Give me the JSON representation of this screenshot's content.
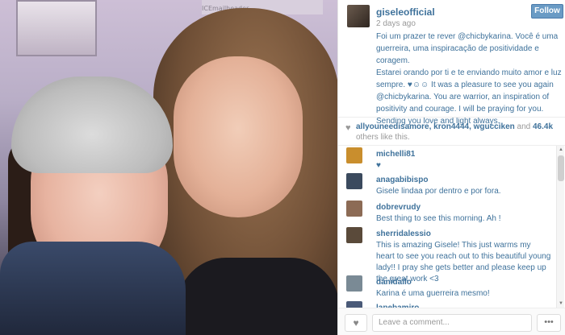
{
  "photo": {
    "watermark": "ICEmailheader"
  },
  "post": {
    "username": "giseleofficial",
    "follow_label": "Follow",
    "time_ago": "2 days ago",
    "caption_lines": [
      "Foi um prazer te rever @chicbykarina. Você é uma",
      "guerreira, uma inspiracação de positividade e coragem.",
      "Estarei orando por ti e te enviando muito amor e luz",
      "sempre. ♥☺☺ It was a pleasure to see you again",
      "@chicbykarina. You are warrior, an inspiration of",
      "positivity and courage. I will be praying for you.",
      "Sending you love and light always."
    ],
    "likes": {
      "heart_icon": "heart-icon",
      "users": "allyouneedisamore, kron4444, wgucciken",
      "and": "and",
      "count": "46.4k",
      "suffix": "others like this."
    }
  },
  "comments": [
    {
      "user": "michelli81",
      "text": "♥",
      "avatar_color": "#c98e2d"
    },
    {
      "user": "anagabibispo",
      "text": "Gisele lindaa por dentro e por fora.",
      "avatar_color": "#3b4a5e"
    },
    {
      "user": "dobrevrudy",
      "text": "Best thing to see this morning. Ah !",
      "avatar_color": "#8c6b55"
    },
    {
      "user": "sherridalessio",
      "text": "This is amazing Gisele! This just warms my heart to see you reach out to this beautiful young lady!! I pray she gets better and please keep up the great work <3",
      "avatar_color": "#5a4a3a"
    },
    {
      "user": "danidallo",
      "text": "Karina é uma guerreira mesmo!",
      "avatar_color": "#7a8a95"
    },
    {
      "user": "lapebamiro",
      "text": "",
      "avatar_color": "#4a5a78"
    }
  ],
  "footer": {
    "comment_placeholder": "Leave a comment...",
    "more_label": "•••"
  },
  "colors": {
    "link": "#3f729b",
    "follow_bg": "#6a9bc5",
    "muted": "#999999"
  }
}
